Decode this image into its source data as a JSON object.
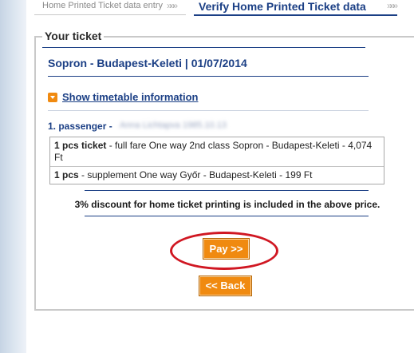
{
  "breadcrumb": {
    "step1": "Home Printed Ticket data entry",
    "separator": "»»»",
    "step2": "Verify Home Printed Ticket data",
    "trailing": "»»»"
  },
  "section": {
    "legend": "Your ticket",
    "journey": "Sopron - Budapest-Keleti | 01/07/2014",
    "timetable_link": "Show timetable information"
  },
  "passenger": {
    "label": "1. passenger -",
    "name_redacted": "Anna Lichtapva 1985.10.13"
  },
  "tickets": [
    {
      "qty": "1 pcs ticket",
      "desc": " - full fare One way 2nd class Sopron - Budapest-Keleti - 4,074 Ft"
    },
    {
      "qty": "1 pcs",
      "desc": " - supplement One way Győr - Budapest-Keleti - 199 Ft"
    }
  ],
  "discount_note": "3% discount for home ticket printing is included in the above price.",
  "buttons": {
    "pay": "Pay >>",
    "back": "<< Back"
  },
  "colors": {
    "accent_blue": "#1b3f85",
    "button_orange": "#f08a10",
    "highlight_red": "#d01722"
  }
}
